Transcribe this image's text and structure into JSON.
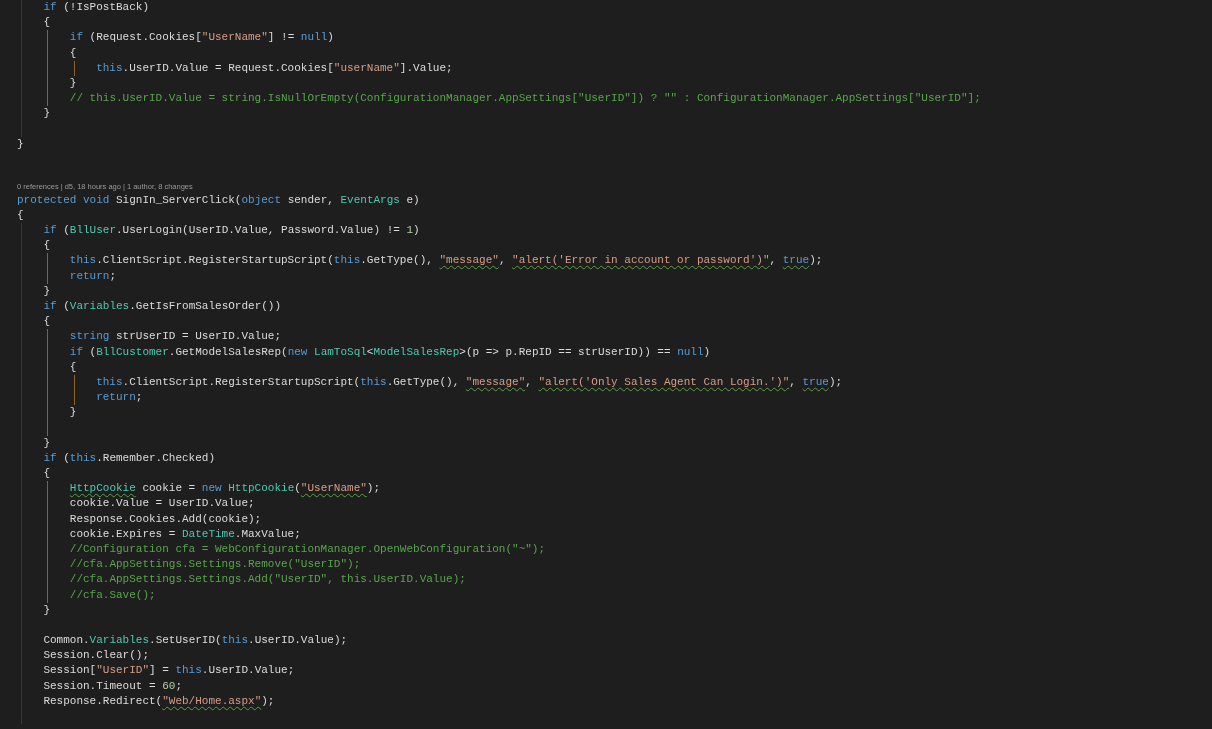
{
  "editor": {
    "lines": [
      {
        "kind": "block",
        "children": [
          {
            "kind": "line",
            "tokens": [
              {
                "text": "if",
                "kind": "keyword",
                "squiggle": false
              },
              {
                "text": " (!IsPostBack)",
                "kind": "plain",
                "squiggle": false
              }
            ]
          },
          {
            "kind": "line",
            "tokens": [
              {
                "text": "{",
                "kind": "plain",
                "squiggle": false
              }
            ]
          },
          {
            "kind": "block",
            "children": [
              {
                "kind": "line",
                "tokens": [
                  {
                    "text": "if",
                    "kind": "keyword",
                    "squiggle": false
                  },
                  {
                    "text": " (Request.Cookies[",
                    "kind": "plain",
                    "squiggle": false
                  },
                  {
                    "text": "\"UserName\"",
                    "kind": "string",
                    "squiggle": false
                  },
                  {
                    "text": "] != ",
                    "kind": "plain",
                    "squiggle": false
                  },
                  {
                    "text": "null",
                    "kind": "keyword",
                    "squiggle": false
                  },
                  {
                    "text": ")",
                    "kind": "plain",
                    "squiggle": false
                  }
                ]
              },
              {
                "kind": "line",
                "tokens": [
                  {
                    "text": "{",
                    "kind": "plain",
                    "squiggle": false
                  }
                ]
              },
              {
                "kind": "block",
                "children": [
                  {
                    "kind": "line",
                    "tokens": [
                      {
                        "text": "this",
                        "kind": "keyword",
                        "squiggle": false
                      },
                      {
                        "text": ".UserID.Value = Request.Cookies[",
                        "kind": "plain",
                        "squiggle": false
                      },
                      {
                        "text": "\"userName\"",
                        "kind": "string",
                        "squiggle": false
                      },
                      {
                        "text": "].Value;",
                        "kind": "plain",
                        "squiggle": false
                      }
                    ]
                  }
                ]
              },
              {
                "kind": "line",
                "tokens": [
                  {
                    "text": "}",
                    "kind": "plain",
                    "squiggle": false
                  }
                ]
              },
              {
                "kind": "line",
                "tokens": [
                  {
                    "text": "// this.UserID.Value = string.IsNullOrEmpty(ConfigurationManager.AppSettings[\"UserID\"]) ? \"\" : ConfigurationManager.AppSettings[\"UserID\"];",
                    "kind": "comment",
                    "squiggle": false
                  }
                ]
              }
            ]
          },
          {
            "kind": "line",
            "tokens": [
              {
                "text": "}",
                "kind": "plain",
                "squiggle": false
              }
            ]
          },
          {
            "kind": "blank"
          }
        ]
      },
      {
        "kind": "line",
        "tokens": [
          {
            "text": "}",
            "kind": "plain",
            "squiggle": false
          }
        ]
      },
      {
        "kind": "blank"
      },
      {
        "kind": "blank"
      },
      {
        "kind": "codelens",
        "parts": [
          {
            "kind": "link",
            "text": "0 references"
          },
          {
            "kind": "separator",
            "text": "|"
          },
          {
            "kind": "link",
            "text": "d5, 18 hours ago"
          },
          {
            "kind": "separator",
            "text": "|"
          },
          {
            "kind": "link",
            "text": "1 author, 8 changes"
          }
        ]
      },
      {
        "kind": "line",
        "tokens": [
          {
            "text": "protected void",
            "kind": "keyword",
            "squiggle": false
          },
          {
            "text": " SignIn_ServerClick(",
            "kind": "plain",
            "squiggle": false
          },
          {
            "text": "object",
            "kind": "keyword",
            "squiggle": false
          },
          {
            "text": " sender, ",
            "kind": "plain",
            "squiggle": false
          },
          {
            "text": "EventArgs",
            "kind": "type",
            "squiggle": false
          },
          {
            "text": " e)",
            "kind": "plain",
            "squiggle": false
          }
        ]
      },
      {
        "kind": "line",
        "tokens": [
          {
            "text": "{",
            "kind": "plain",
            "squiggle": false
          }
        ]
      },
      {
        "kind": "block",
        "children": [
          {
            "kind": "line",
            "tokens": [
              {
                "text": "if",
                "kind": "keyword",
                "squiggle": false
              },
              {
                "text": " (",
                "kind": "plain",
                "squiggle": false
              },
              {
                "text": "BllUser",
                "kind": "type",
                "squiggle": false
              },
              {
                "text": ".UserLogin(UserID.Value, Password.Value) != ",
                "kind": "plain",
                "squiggle": false
              },
              {
                "text": "1",
                "kind": "number",
                "squiggle": false
              },
              {
                "text": ")",
                "kind": "plain",
                "squiggle": false
              }
            ]
          },
          {
            "kind": "line",
            "tokens": [
              {
                "text": "{",
                "kind": "plain",
                "squiggle": false
              }
            ]
          },
          {
            "kind": "block",
            "children": [
              {
                "kind": "line",
                "tokens": [
                  {
                    "text": "this",
                    "kind": "keyword",
                    "squiggle": false
                  },
                  {
                    "text": ".ClientScript.RegisterStartupScript(",
                    "kind": "plain",
                    "squiggle": false
                  },
                  {
                    "text": "this",
                    "kind": "keyword",
                    "squiggle": false
                  },
                  {
                    "text": ".GetType(), ",
                    "kind": "plain",
                    "squiggle": false
                  },
                  {
                    "text": "\"message\"",
                    "kind": "string",
                    "squiggle": true
                  },
                  {
                    "text": ", ",
                    "kind": "plain",
                    "squiggle": false
                  },
                  {
                    "text": "\"alert('Error in account or password')\"",
                    "kind": "string",
                    "squiggle": true
                  },
                  {
                    "text": ", ",
                    "kind": "plain",
                    "squiggle": false
                  },
                  {
                    "text": "true",
                    "kind": "keyword",
                    "squiggle": true
                  },
                  {
                    "text": ");",
                    "kind": "plain",
                    "squiggle": false
                  }
                ]
              },
              {
                "kind": "line",
                "tokens": [
                  {
                    "text": "return",
                    "kind": "keyword",
                    "squiggle": false
                  },
                  {
                    "text": ";",
                    "kind": "plain",
                    "squiggle": false
                  }
                ]
              }
            ]
          },
          {
            "kind": "line",
            "tokens": [
              {
                "text": "}",
                "kind": "plain",
                "squiggle": false
              }
            ]
          },
          {
            "kind": "line",
            "tokens": [
              {
                "text": "if",
                "kind": "keyword",
                "squiggle": false
              },
              {
                "text": " (",
                "kind": "plain",
                "squiggle": false
              },
              {
                "text": "Variables",
                "kind": "type",
                "squiggle": false
              },
              {
                "text": ".GetIsFromSalesOrder())",
                "kind": "plain",
                "squiggle": false
              }
            ]
          },
          {
            "kind": "line",
            "tokens": [
              {
                "text": "{",
                "kind": "plain",
                "squiggle": false
              }
            ]
          },
          {
            "kind": "block",
            "children": [
              {
                "kind": "line",
                "tokens": [
                  {
                    "text": "string",
                    "kind": "keyword",
                    "squiggle": false
                  },
                  {
                    "text": " strUserID = UserID.Value;",
                    "kind": "plain",
                    "squiggle": false
                  }
                ]
              },
              {
                "kind": "line",
                "tokens": [
                  {
                    "text": "if",
                    "kind": "keyword",
                    "squiggle": false
                  },
                  {
                    "text": " (",
                    "kind": "plain",
                    "squiggle": false
                  },
                  {
                    "text": "BllCustomer",
                    "kind": "type",
                    "squiggle": false
                  },
                  {
                    "text": ".GetModelSalesRep(",
                    "kind": "plain",
                    "squiggle": false
                  },
                  {
                    "text": "new ",
                    "kind": "keyword",
                    "squiggle": false
                  },
                  {
                    "text": "LamToSql",
                    "kind": "type",
                    "squiggle": false
                  },
                  {
                    "text": "<",
                    "kind": "plain",
                    "squiggle": false
                  },
                  {
                    "text": "ModelSalesRep",
                    "kind": "type",
                    "squiggle": false
                  },
                  {
                    "text": ">(p => p.RepID == strUserID)) == ",
                    "kind": "plain",
                    "squiggle": false
                  },
                  {
                    "text": "null",
                    "kind": "keyword",
                    "squiggle": false
                  },
                  {
                    "text": ")",
                    "kind": "plain",
                    "squiggle": false
                  }
                ]
              },
              {
                "kind": "line",
                "tokens": [
                  {
                    "text": "{",
                    "kind": "plain",
                    "squiggle": false
                  }
                ]
              },
              {
                "kind": "block",
                "children": [
                  {
                    "kind": "line",
                    "tokens": [
                      {
                        "text": "this",
                        "kind": "keyword",
                        "squiggle": false
                      },
                      {
                        "text": ".ClientScript.RegisterStartupScript(",
                        "kind": "plain",
                        "squiggle": false
                      },
                      {
                        "text": "this",
                        "kind": "keyword",
                        "squiggle": false
                      },
                      {
                        "text": ".GetType(), ",
                        "kind": "plain",
                        "squiggle": false
                      },
                      {
                        "text": "\"message\"",
                        "kind": "string",
                        "squiggle": true
                      },
                      {
                        "text": ", ",
                        "kind": "plain",
                        "squiggle": false
                      },
                      {
                        "text": "\"alert('Only Sales Agent Can Login.')\"",
                        "kind": "string",
                        "squiggle": true
                      },
                      {
                        "text": ", ",
                        "kind": "plain",
                        "squiggle": false
                      },
                      {
                        "text": "true",
                        "kind": "keyword",
                        "squiggle": true
                      },
                      {
                        "text": ");",
                        "kind": "plain",
                        "squiggle": false
                      }
                    ]
                  },
                  {
                    "kind": "line",
                    "tokens": [
                      {
                        "text": "return",
                        "kind": "keyword",
                        "squiggle": false
                      },
                      {
                        "text": ";",
                        "kind": "plain",
                        "squiggle": false
                      }
                    ]
                  }
                ]
              },
              {
                "kind": "line",
                "tokens": [
                  {
                    "text": "}",
                    "kind": "plain",
                    "squiggle": false
                  }
                ]
              },
              {
                "kind": "blank"
              }
            ]
          },
          {
            "kind": "line",
            "tokens": [
              {
                "text": "}",
                "kind": "plain",
                "squiggle": false
              }
            ]
          },
          {
            "kind": "line",
            "tokens": [
              {
                "text": "if",
                "kind": "keyword",
                "squiggle": false
              },
              {
                "text": " (",
                "kind": "plain",
                "squiggle": false
              },
              {
                "text": "this",
                "kind": "keyword",
                "squiggle": false
              },
              {
                "text": ".Remember.Checked)",
                "kind": "plain",
                "squiggle": false
              }
            ]
          },
          {
            "kind": "line",
            "tokens": [
              {
                "text": "{",
                "kind": "plain",
                "squiggle": false
              }
            ]
          },
          {
            "kind": "block",
            "children": [
              {
                "kind": "line",
                "tokens": [
                  {
                    "text": "HttpCookie",
                    "kind": "type",
                    "squiggle": true
                  },
                  {
                    "text": " cookie = ",
                    "kind": "plain",
                    "squiggle": false
                  },
                  {
                    "text": "new ",
                    "kind": "keyword",
                    "squiggle": false
                  },
                  {
                    "text": "HttpCookie",
                    "kind": "type",
                    "squiggle": false
                  },
                  {
                    "text": "(",
                    "kind": "plain",
                    "squiggle": false
                  },
                  {
                    "text": "\"UserName\"",
                    "kind": "string",
                    "squiggle": true
                  },
                  {
                    "text": ");",
                    "kind": "plain",
                    "squiggle": false
                  }
                ]
              },
              {
                "kind": "line",
                "tokens": [
                  {
                    "text": "cookie.Value = UserID.Value;",
                    "kind": "plain",
                    "squiggle": false
                  }
                ]
              },
              {
                "kind": "line",
                "tokens": [
                  {
                    "text": "Response.Cookies.Add(cookie);",
                    "kind": "plain",
                    "squiggle": false
                  }
                ]
              },
              {
                "kind": "line",
                "tokens": [
                  {
                    "text": "cookie.Expires = ",
                    "kind": "plain",
                    "squiggle": false
                  },
                  {
                    "text": "DateTime",
                    "kind": "type",
                    "squiggle": false
                  },
                  {
                    "text": ".MaxValue;",
                    "kind": "plain",
                    "squiggle": false
                  }
                ]
              },
              {
                "kind": "line",
                "tokens": [
                  {
                    "text": "//Configuration cfa = WebConfigurationManager.OpenWebConfiguration(\"~\");",
                    "kind": "comment",
                    "squiggle": false
                  }
                ]
              },
              {
                "kind": "line",
                "tokens": [
                  {
                    "text": "//cfa.AppSettings.Settings.Remove(\"UserID\");",
                    "kind": "comment",
                    "squiggle": false
                  }
                ]
              },
              {
                "kind": "line",
                "tokens": [
                  {
                    "text": "//cfa.AppSettings.Settings.Add(\"UserID\", this.UserID.Value);",
                    "kind": "comment",
                    "squiggle": false
                  }
                ]
              },
              {
                "kind": "line",
                "tokens": [
                  {
                    "text": "//cfa.Save();",
                    "kind": "comment",
                    "squiggle": false
                  }
                ]
              }
            ]
          },
          {
            "kind": "line",
            "tokens": [
              {
                "text": "}",
                "kind": "plain",
                "squiggle": false
              }
            ]
          },
          {
            "kind": "blank"
          },
          {
            "kind": "line",
            "tokens": [
              {
                "text": "Common.",
                "kind": "plain",
                "squiggle": false
              },
              {
                "text": "Variables",
                "kind": "type",
                "squiggle": false
              },
              {
                "text": ".SetUserID(",
                "kind": "plain",
                "squiggle": false
              },
              {
                "text": "this",
                "kind": "keyword",
                "squiggle": false
              },
              {
                "text": ".UserID.Value);",
                "kind": "plain",
                "squiggle": false
              }
            ]
          },
          {
            "kind": "line",
            "tokens": [
              {
                "text": "Session.Clear();",
                "kind": "plain",
                "squiggle": false
              }
            ]
          },
          {
            "kind": "line",
            "tokens": [
              {
                "text": "Session[",
                "kind": "plain",
                "squiggle": false
              },
              {
                "text": "\"UserID\"",
                "kind": "string",
                "squiggle": false
              },
              {
                "text": "] = ",
                "kind": "plain",
                "squiggle": false
              },
              {
                "text": "this",
                "kind": "keyword",
                "squiggle": false
              },
              {
                "text": ".UserID.Value;",
                "kind": "plain",
                "squiggle": false
              }
            ]
          },
          {
            "kind": "line",
            "tokens": [
              {
                "text": "Session.Timeout = ",
                "kind": "plain",
                "squiggle": false
              },
              {
                "text": "60",
                "kind": "number",
                "squiggle": false
              },
              {
                "text": ";",
                "kind": "plain",
                "squiggle": false
              }
            ]
          },
          {
            "kind": "line",
            "tokens": [
              {
                "text": "Response.Redirect(",
                "kind": "plain",
                "squiggle": false
              },
              {
                "text": "\"Web/Home.aspx\"",
                "kind": "string",
                "squiggle": true
              },
              {
                "text": ");",
                "kind": "plain",
                "squiggle": false
              }
            ]
          },
          {
            "kind": "blank"
          }
        ]
      }
    ]
  }
}
